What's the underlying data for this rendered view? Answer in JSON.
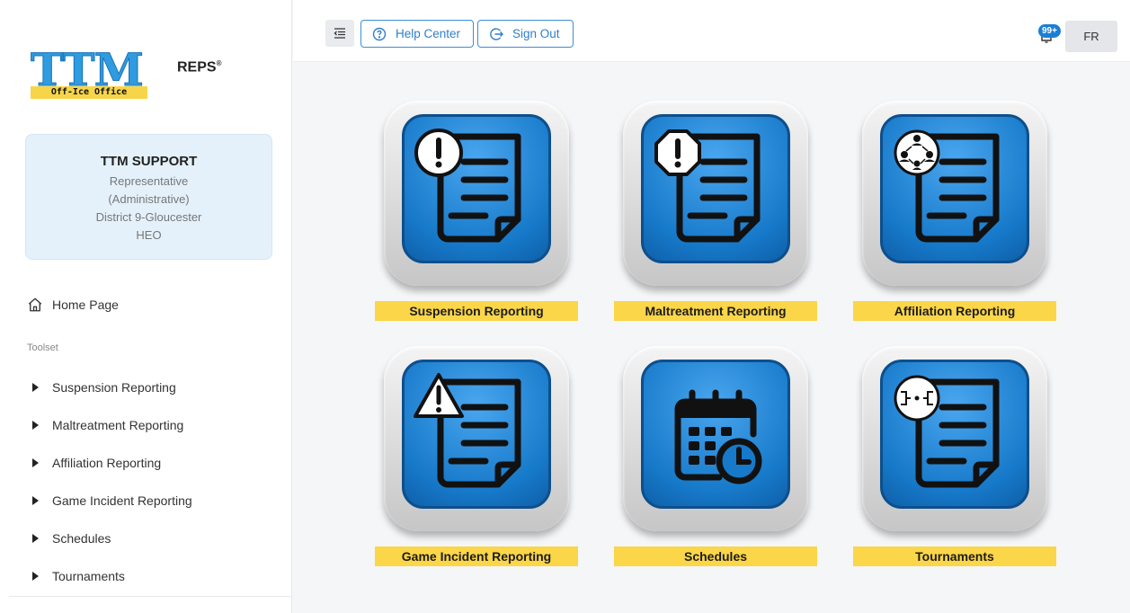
{
  "logo": {
    "main": "TTM",
    "tagline": "Off-Ice Office",
    "product": "REPS",
    "reg_mark": "®"
  },
  "profile": {
    "name": "TTM SUPPORT",
    "lines": [
      "Representative",
      "(Administrative)",
      "District 9-Gloucester",
      "HEO"
    ]
  },
  "nav": {
    "home": "Home Page",
    "section": "Toolset",
    "items": [
      {
        "label": "Suspension Reporting"
      },
      {
        "label": "Maltreatment Reporting"
      },
      {
        "label": "Affiliation Reporting"
      },
      {
        "label": "Game Incident Reporting"
      },
      {
        "label": "Schedules"
      },
      {
        "label": "Tournaments"
      }
    ]
  },
  "topbar": {
    "help": "Help Center",
    "signout": "Sign Out",
    "notifications": "99+",
    "language": "FR"
  },
  "tiles": [
    {
      "label": "Suspension Reporting",
      "icon": "document-exclamation-circle-icon"
    },
    {
      "label": "Maltreatment Reporting",
      "icon": "document-exclamation-octagon-icon"
    },
    {
      "label": "Affiliation Reporting",
      "icon": "document-network-icon"
    },
    {
      "label": "Game Incident Reporting",
      "icon": "document-warning-triangle-icon"
    },
    {
      "label": "Schedules",
      "icon": "calendar-clock-icon"
    },
    {
      "label": "Tournaments",
      "icon": "document-bracket-icon"
    }
  ],
  "colors": {
    "accent": "#2f7fc9",
    "label_bg": "#fbd648",
    "tile_blue": "#1679c9",
    "profile_bg": "#e4f1fb"
  }
}
